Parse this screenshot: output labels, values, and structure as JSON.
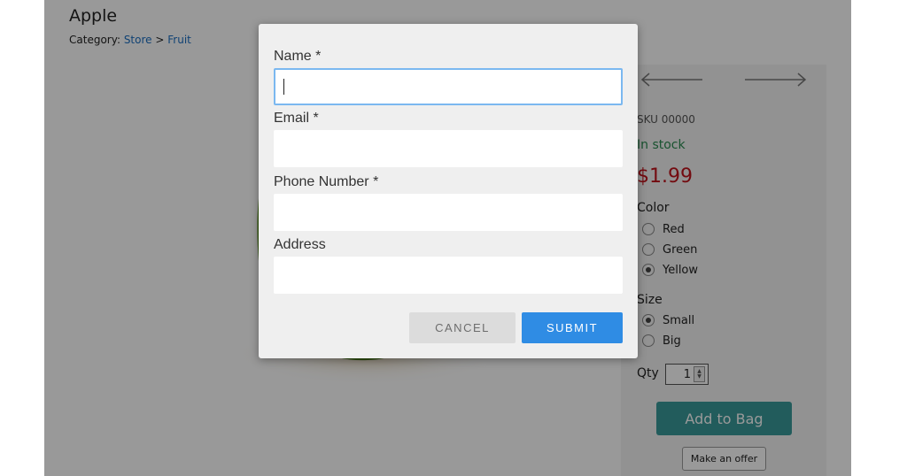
{
  "product": {
    "title": "Apple",
    "breadcrumb": {
      "prefix": "Category:",
      "store": "Store",
      "separator": ">",
      "fruit": "Fruit"
    },
    "sku": "SKU 00000",
    "stock": "In stock",
    "price": "$1.99",
    "color_label": "Color",
    "colors": [
      {
        "label": "Red",
        "selected": false
      },
      {
        "label": "Green",
        "selected": false
      },
      {
        "label": "Yellow",
        "selected": true
      }
    ],
    "size_label": "Size",
    "sizes": [
      {
        "label": "Small",
        "selected": true
      },
      {
        "label": "Big",
        "selected": false
      }
    ],
    "qty_label": "Qty",
    "qty_value": "1",
    "add_to_bag": "Add to Bag",
    "make_offer": "Make an offer"
  },
  "modal": {
    "name_label": "Name *",
    "name_value": "",
    "email_label": "Email *",
    "email_value": "",
    "phone_label": "Phone Number *",
    "phone_value": "",
    "address_label": "Address",
    "address_value": "",
    "cancel_label": "CANCEL",
    "submit_label": "SUBMIT"
  },
  "colors": {
    "link": "#1b6ec2",
    "stock": "#2a8a50",
    "price": "#c0131b",
    "add_to_bag_bg": "#3a9a9a",
    "submit_bg": "#2f8ce4",
    "focus_border": "#7bb8f0"
  }
}
